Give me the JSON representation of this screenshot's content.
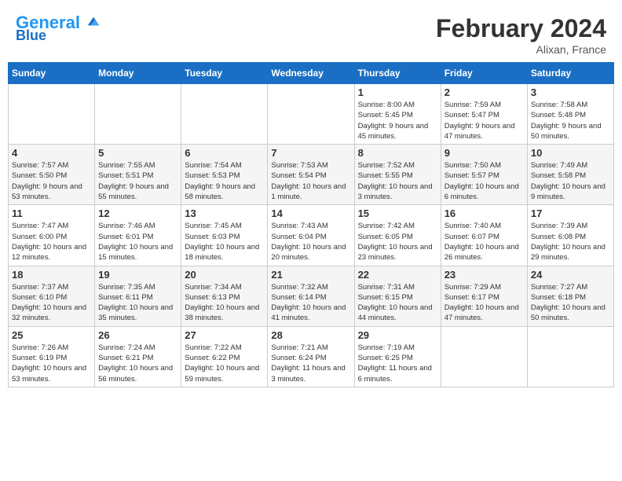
{
  "header": {
    "logo_general": "General",
    "logo_blue": "Blue",
    "month": "February 2024",
    "location": "Alixan, France"
  },
  "weekdays": [
    "Sunday",
    "Monday",
    "Tuesday",
    "Wednesday",
    "Thursday",
    "Friday",
    "Saturday"
  ],
  "weeks": [
    {
      "shaded": false,
      "days": [
        {
          "num": "",
          "empty": true
        },
        {
          "num": "",
          "empty": true
        },
        {
          "num": "",
          "empty": true
        },
        {
          "num": "",
          "empty": true
        },
        {
          "num": "1",
          "sunrise": "8:00 AM",
          "sunset": "5:45 PM",
          "daylight": "9 hours and 45 minutes."
        },
        {
          "num": "2",
          "sunrise": "7:59 AM",
          "sunset": "5:47 PM",
          "daylight": "9 hours and 47 minutes."
        },
        {
          "num": "3",
          "sunrise": "7:58 AM",
          "sunset": "5:48 PM",
          "daylight": "9 hours and 50 minutes."
        }
      ]
    },
    {
      "shaded": true,
      "days": [
        {
          "num": "4",
          "sunrise": "7:57 AM",
          "sunset": "5:50 PM",
          "daylight": "9 hours and 53 minutes."
        },
        {
          "num": "5",
          "sunrise": "7:55 AM",
          "sunset": "5:51 PM",
          "daylight": "9 hours and 55 minutes."
        },
        {
          "num": "6",
          "sunrise": "7:54 AM",
          "sunset": "5:53 PM",
          "daylight": "9 hours and 58 minutes."
        },
        {
          "num": "7",
          "sunrise": "7:53 AM",
          "sunset": "5:54 PM",
          "daylight": "10 hours and 1 minute."
        },
        {
          "num": "8",
          "sunrise": "7:52 AM",
          "sunset": "5:55 PM",
          "daylight": "10 hours and 3 minutes."
        },
        {
          "num": "9",
          "sunrise": "7:50 AM",
          "sunset": "5:57 PM",
          "daylight": "10 hours and 6 minutes."
        },
        {
          "num": "10",
          "sunrise": "7:49 AM",
          "sunset": "5:58 PM",
          "daylight": "10 hours and 9 minutes."
        }
      ]
    },
    {
      "shaded": false,
      "days": [
        {
          "num": "11",
          "sunrise": "7:47 AM",
          "sunset": "6:00 PM",
          "daylight": "10 hours and 12 minutes."
        },
        {
          "num": "12",
          "sunrise": "7:46 AM",
          "sunset": "6:01 PM",
          "daylight": "10 hours and 15 minutes."
        },
        {
          "num": "13",
          "sunrise": "7:45 AM",
          "sunset": "6:03 PM",
          "daylight": "10 hours and 18 minutes."
        },
        {
          "num": "14",
          "sunrise": "7:43 AM",
          "sunset": "6:04 PM",
          "daylight": "10 hours and 20 minutes."
        },
        {
          "num": "15",
          "sunrise": "7:42 AM",
          "sunset": "6:05 PM",
          "daylight": "10 hours and 23 minutes."
        },
        {
          "num": "16",
          "sunrise": "7:40 AM",
          "sunset": "6:07 PM",
          "daylight": "10 hours and 26 minutes."
        },
        {
          "num": "17",
          "sunrise": "7:39 AM",
          "sunset": "6:08 PM",
          "daylight": "10 hours and 29 minutes."
        }
      ]
    },
    {
      "shaded": true,
      "days": [
        {
          "num": "18",
          "sunrise": "7:37 AM",
          "sunset": "6:10 PM",
          "daylight": "10 hours and 32 minutes."
        },
        {
          "num": "19",
          "sunrise": "7:35 AM",
          "sunset": "6:11 PM",
          "daylight": "10 hours and 35 minutes."
        },
        {
          "num": "20",
          "sunrise": "7:34 AM",
          "sunset": "6:13 PM",
          "daylight": "10 hours and 38 minutes."
        },
        {
          "num": "21",
          "sunrise": "7:32 AM",
          "sunset": "6:14 PM",
          "daylight": "10 hours and 41 minutes."
        },
        {
          "num": "22",
          "sunrise": "7:31 AM",
          "sunset": "6:15 PM",
          "daylight": "10 hours and 44 minutes."
        },
        {
          "num": "23",
          "sunrise": "7:29 AM",
          "sunset": "6:17 PM",
          "daylight": "10 hours and 47 minutes."
        },
        {
          "num": "24",
          "sunrise": "7:27 AM",
          "sunset": "6:18 PM",
          "daylight": "10 hours and 50 minutes."
        }
      ]
    },
    {
      "shaded": false,
      "days": [
        {
          "num": "25",
          "sunrise": "7:26 AM",
          "sunset": "6:19 PM",
          "daylight": "10 hours and 53 minutes."
        },
        {
          "num": "26",
          "sunrise": "7:24 AM",
          "sunset": "6:21 PM",
          "daylight": "10 hours and 56 minutes."
        },
        {
          "num": "27",
          "sunrise": "7:22 AM",
          "sunset": "6:22 PM",
          "daylight": "10 hours and 59 minutes."
        },
        {
          "num": "28",
          "sunrise": "7:21 AM",
          "sunset": "6:24 PM",
          "daylight": "11 hours and 3 minutes."
        },
        {
          "num": "29",
          "sunrise": "7:19 AM",
          "sunset": "6:25 PM",
          "daylight": "11 hours and 6 minutes."
        },
        {
          "num": "",
          "empty": true
        },
        {
          "num": "",
          "empty": true
        }
      ]
    }
  ],
  "labels": {
    "sunrise": "Sunrise:",
    "sunset": "Sunset:",
    "daylight": "Daylight:"
  }
}
